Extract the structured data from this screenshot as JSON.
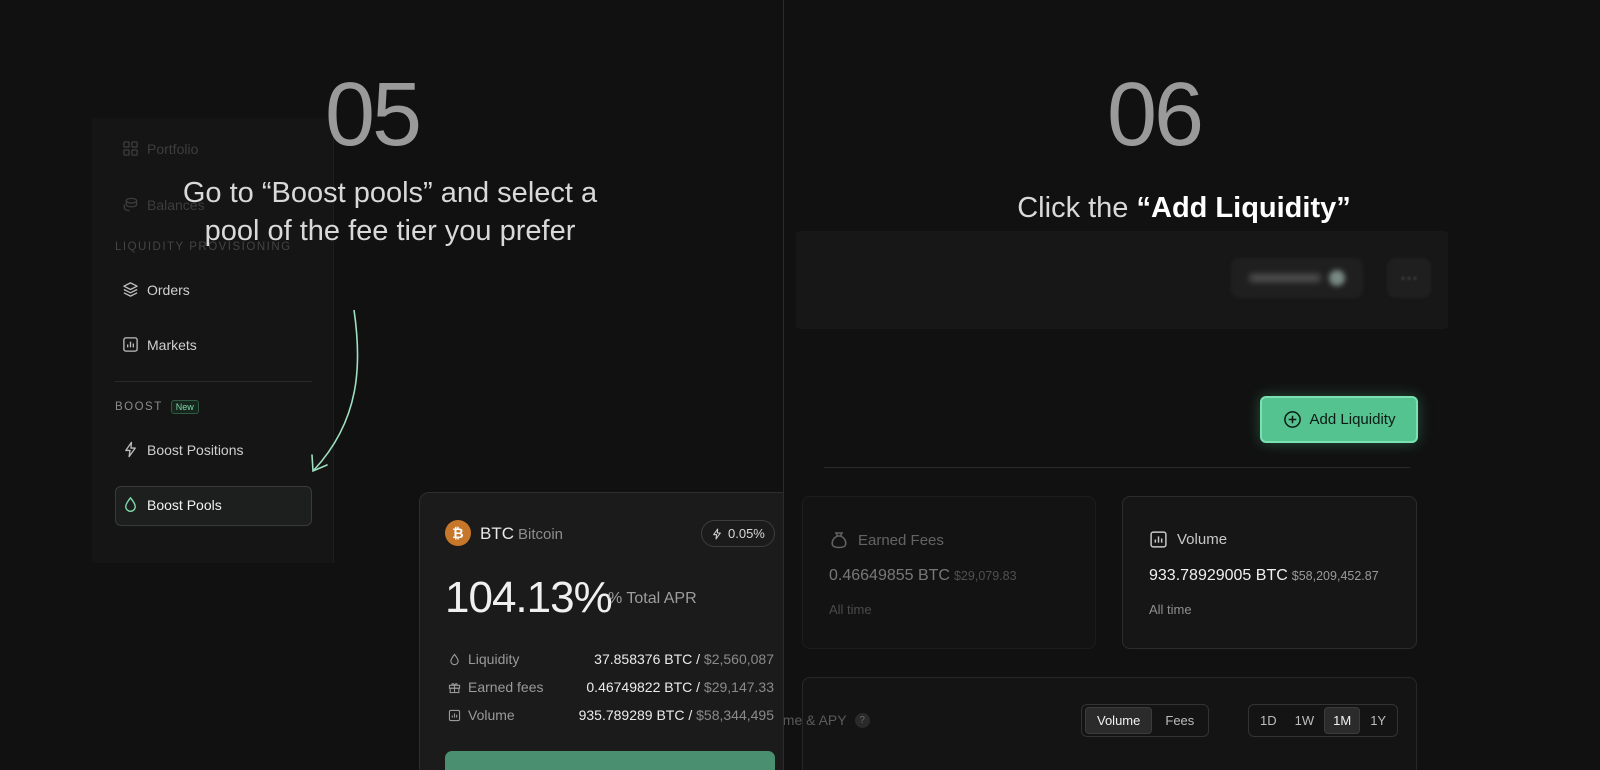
{
  "step5": {
    "number": "05",
    "title_line1": "Go to “Boost pools” and select a",
    "title_line2": "pool of the fee tier you prefer",
    "sidebar": {
      "portfolio": "Portfolio",
      "balances": "Balances",
      "section_lp": "LIQUIDITY PROVISIONING",
      "orders": "Orders",
      "markets": "Markets",
      "section_boost": "BOOST",
      "badge_new": "New",
      "boost_positions": "Boost Positions",
      "boost_pools": "Boost Pools"
    },
    "pool_card": {
      "coin_symbol": "₿",
      "ticker": "BTC",
      "name": "Bitcoin",
      "fee_tier": "0.05%",
      "apr_value": "104.13%",
      "apr_label": "% Total APR",
      "liquidity_label": "Liquidity",
      "liquidity_value": "37.858376 BTC /",
      "liquidity_usd": "$2,560,087",
      "earned_label": "Earned fees",
      "earned_value": "0.46749822 BTC /",
      "earned_usd": "$29,147.33",
      "volume_label": "Volume",
      "volume_value": "935.789289 BTC /",
      "volume_usd": "$58,344,495"
    }
  },
  "step6": {
    "number": "06",
    "title_prefix": "Click the",
    "title_bold": "“Add Liquidity”",
    "add_liquidity_label": "Add Liquidity",
    "earned_fees": {
      "label": "Earned Fees",
      "value": "0.46649855 BTC",
      "usd": "$29,079.83",
      "period": "All time"
    },
    "volume": {
      "label": "Volume",
      "value": "933.78929005 BTC",
      "usd": "$58,209,452.87",
      "period": "All time"
    },
    "chart": {
      "title_fragment": "ume & APY",
      "help": "?",
      "metric_options": [
        "Volume",
        "Fees"
      ],
      "metric_selected": "Volume",
      "range_options": [
        "1D",
        "1W",
        "1M",
        "1Y"
      ],
      "range_selected": "1M"
    }
  },
  "colors": {
    "accent_green": "#54c390",
    "btc_orange": "#c7772a",
    "background": "#111111"
  }
}
